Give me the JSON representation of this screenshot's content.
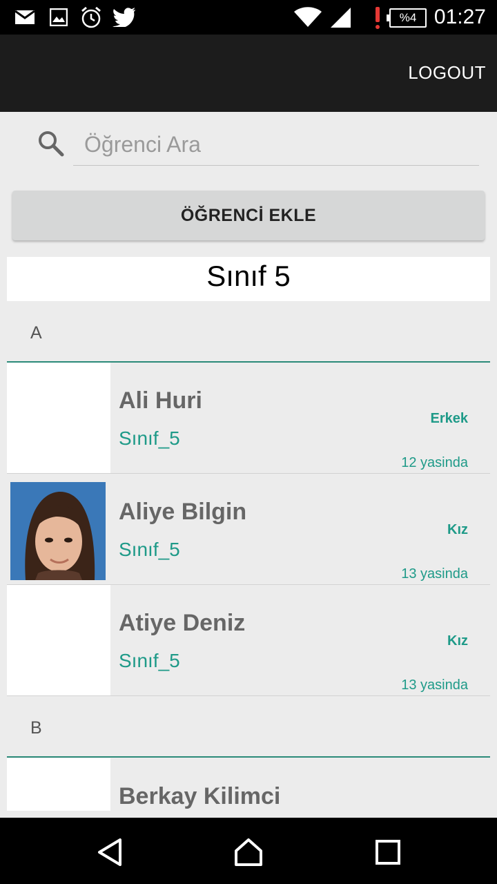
{
  "status_bar": {
    "icons": [
      "mail-icon",
      "image-icon",
      "alarm-icon",
      "twitter-icon",
      "wifi-icon",
      "signal-icon",
      "alert-icon"
    ],
    "battery": "%4",
    "time": "01:27"
  },
  "toolbar": {
    "logout_label": "LOGOUT"
  },
  "search": {
    "placeholder": "Öğrenci Ara",
    "value": ""
  },
  "add_button_label": "ÖĞRENCİ EKLE",
  "class_title": "Sınıf 5",
  "sections": [
    {
      "letter": "A",
      "students": [
        {
          "name": "Ali Huri",
          "class": "Sınıf_5",
          "gender": "Erkek",
          "age": "12 yasinda",
          "has_photo": false
        },
        {
          "name": "Aliye Bilgin",
          "class": "Sınıf_5",
          "gender": "Kız",
          "age": "13 yasinda",
          "has_photo": true
        },
        {
          "name": "Atiye Deniz",
          "class": "Sınıf_5",
          "gender": "Kız",
          "age": "13 yasinda",
          "has_photo": false
        }
      ]
    },
    {
      "letter": "B",
      "students": [
        {
          "name": "Berkay Kilimci",
          "class": "",
          "gender": "",
          "age": "",
          "has_photo": false
        }
      ]
    }
  ],
  "colors": {
    "accent": "#1e9a88",
    "divider": "#2a8a78",
    "toolbar": "#1c1c1c",
    "background": "#ececec"
  }
}
